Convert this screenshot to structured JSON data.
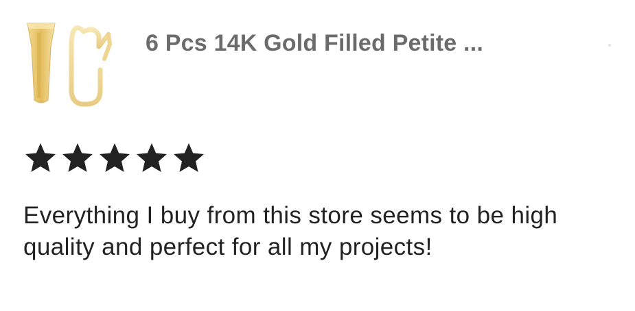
{
  "product": {
    "title": "6 Pcs 14K Gold Filled Petite ...",
    "image_icon": "gold-bail-jewelry-image"
  },
  "rating": {
    "value": 5,
    "max": 5,
    "star_color": "#222222",
    "icon": "star-icon"
  },
  "review": {
    "text": "Everything I buy from this store seems to be high quality and perfect for all my projects!"
  },
  "colors": {
    "title": "#6b6b6b",
    "body_text": "#222222",
    "gold": "#e7c779"
  }
}
